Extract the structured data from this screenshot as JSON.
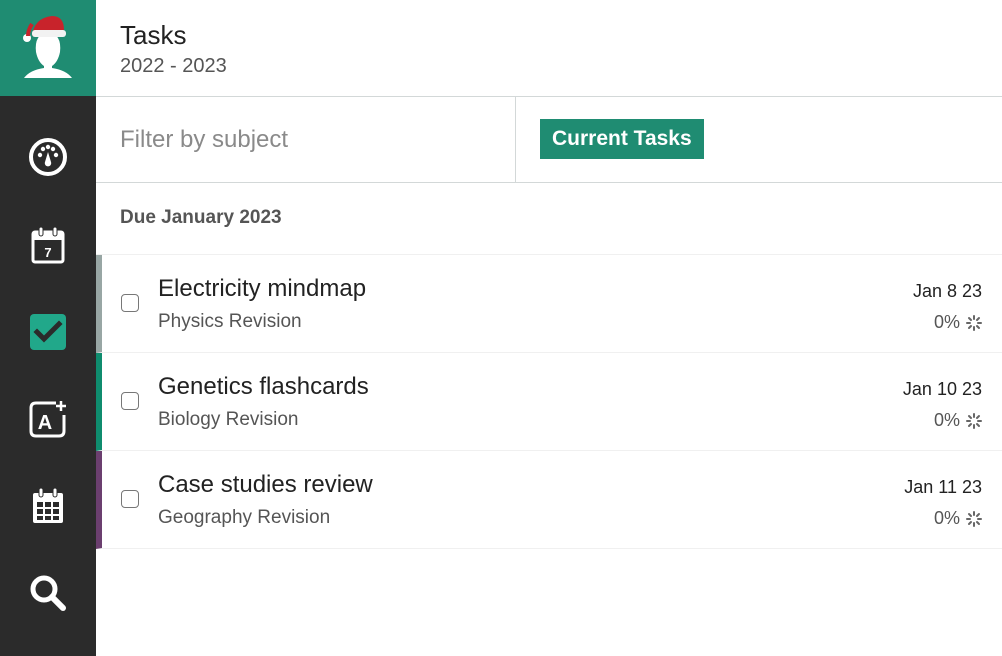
{
  "sidebar": {
    "avatar_icon": "santa-hat-user-icon",
    "items": [
      {
        "name": "dashboard",
        "icon": "dashboard-gauge-icon",
        "active": false
      },
      {
        "name": "calendar-day",
        "icon": "calendar-7-icon",
        "day": "7",
        "active": false
      },
      {
        "name": "tasks",
        "icon": "task-check-icon",
        "active": true
      },
      {
        "name": "grades",
        "icon": "grade-a-plus-icon",
        "active": false
      },
      {
        "name": "timetable",
        "icon": "calendar-grid-icon",
        "active": false
      },
      {
        "name": "search",
        "icon": "search-icon",
        "active": false
      }
    ]
  },
  "header": {
    "title": "Tasks",
    "subtitle": "2022 - 2023"
  },
  "filter": {
    "placeholder": "Filter by subject",
    "value": "",
    "current_tasks_label": "Current Tasks"
  },
  "colors": {
    "accent": "#1f8c72",
    "sidebar_bg": "#2b2b2b",
    "physics": "#98a6a4",
    "biology": "#0f8c6e",
    "geography": "#6b3f6f"
  },
  "group": {
    "heading": "Due January 2023",
    "tasks": [
      {
        "name": "Electricity mindmap",
        "subject": "Physics Revision",
        "date": "Jan 8 23",
        "progress": "0%",
        "color": "#98a6a4",
        "checked": false
      },
      {
        "name": "Genetics flashcards",
        "subject": "Biology Revision",
        "date": "Jan 10 23",
        "progress": "0%",
        "color": "#0f8c6e",
        "checked": false
      },
      {
        "name": "Case studies review",
        "subject": "Geography Revision",
        "date": "Jan 11 23",
        "progress": "0%",
        "color": "#6b3f6f",
        "checked": false
      }
    ]
  }
}
